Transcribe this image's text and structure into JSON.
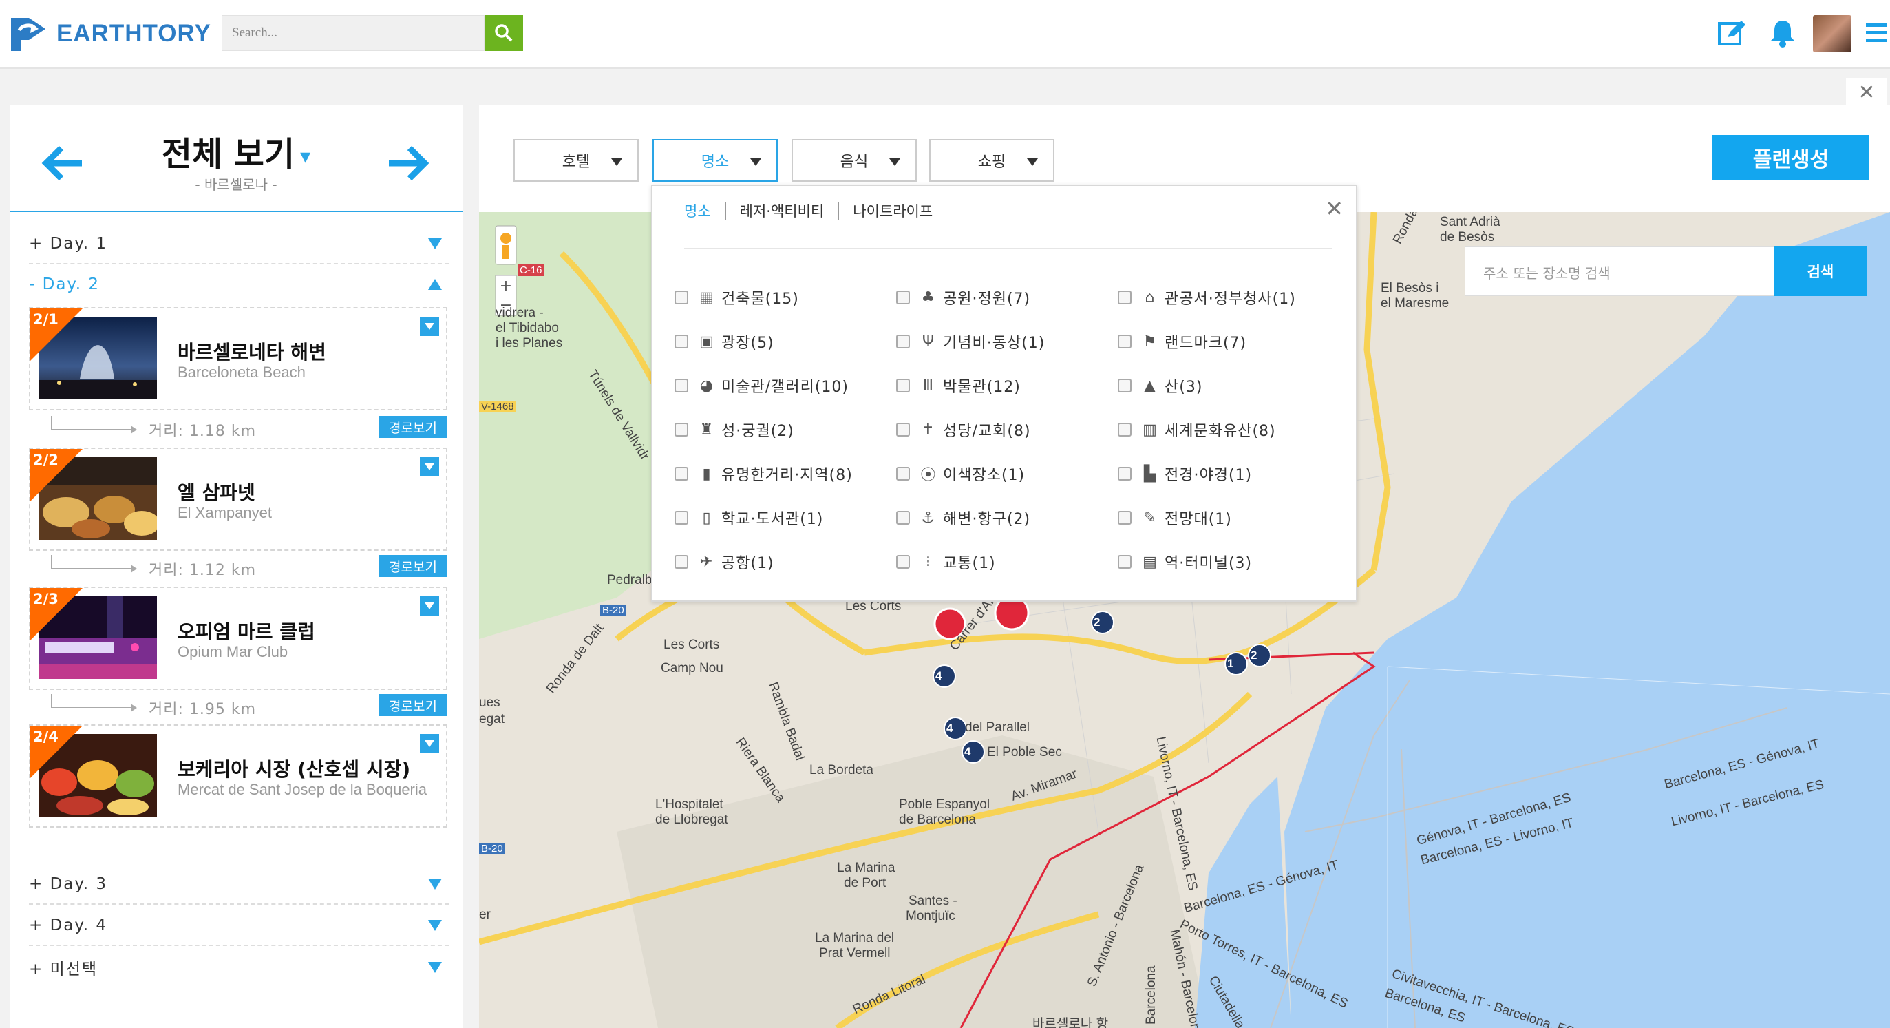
{
  "header": {
    "brand": "EARTHTORY",
    "search_placeholder": "Search...",
    "icons": [
      "edit-icon",
      "bell-icon",
      "avatar",
      "menu-icon"
    ]
  },
  "left_panel": {
    "title": "전체 보기",
    "subtitle": "- 바르셀로나 -",
    "days": {
      "day1": "+ Day. 1",
      "day2": "- Day. 2",
      "day3": "+ Day. 3",
      "day4": "+ Day. 4",
      "unselected": "+ 미선택"
    },
    "places": [
      {
        "badge": "2/1",
        "name": "바르셀로네타 해변",
        "en": "Barceloneta Beach",
        "distance": "거리: 1.18 km",
        "route": "경로보기"
      },
      {
        "badge": "2/2",
        "name": "엘 삼파넷",
        "en": "El Xampanyet",
        "distance": "거리: 1.12 km",
        "route": "경로보기"
      },
      {
        "badge": "2/3",
        "name": "오피엄 마르 클럽",
        "en": "Opium Mar Club",
        "distance": "거리: 1.95 km",
        "route": "경로보기"
      },
      {
        "badge": "2/4",
        "name": "보케리아 시장 (산호셉 시장)",
        "en": "Mercat de Sant Josep de la Boqueria"
      }
    ]
  },
  "filters": {
    "hotel": "호텔",
    "sights": "명소",
    "food": "음식",
    "shopping": "쇼핑",
    "plan_button": "플랜생성"
  },
  "dropdown": {
    "tabs": [
      "명소",
      "레저·액티비티",
      "나이트라이프"
    ],
    "categories": [
      [
        "건축물(15)",
        "공원·정원(7)",
        "관공서·정부청사(1)"
      ],
      [
        "광장(5)",
        "기념비·동상(1)",
        "랜드마크(7)"
      ],
      [
        "미술관/갤러리(10)",
        "박물관(12)",
        "산(3)"
      ],
      [
        "성·궁궐(2)",
        "성당/교회(8)",
        "세계문화유산(8)"
      ],
      [
        "유명한거리·지역(8)",
        "이색장소(1)",
        "전경·야경(1)"
      ],
      [
        "학교·도서관(1)",
        "해변·항구(2)",
        "전망대(1)"
      ],
      [
        "공항(1)",
        "교통(1)",
        "역·터미널(3)"
      ]
    ]
  },
  "map": {
    "search_placeholder": "주소 또는 장소명 검색",
    "search_button": "검색",
    "labels": {
      "sant_adria": "Sant Adrià",
      "de_besos": "de Besòs",
      "el_besos": "El Besòs i",
      "el_maresme": "el Maresme",
      "vidrera": "vidrera -",
      "tibidabo": "el Tibidabo",
      "planes": "i les Planes",
      "c16": "C-16",
      "b20": "B-20",
      "b20b": "B-20",
      "v1468": "V-1468",
      "pedralbes": "Pedralb",
      "les_corts": "Les Corts",
      "les_corts2": "Les Corts",
      "camp_nou": "Camp Nou",
      "ues": "ues",
      "egat": "egat",
      "ronda_dalt": "Ronda de Dalt",
      "rambla_badal": "Rambla Badal",
      "riera_blanca": "Riera Blanca",
      "la_bordeta": "La Bordeta",
      "hospitalet1": "L'Hospitalet",
      "hospitalet2": "de Llobregat",
      "poble_esp1": "Poble Espanyol",
      "poble_esp2": "de Barcelona",
      "el_parallel": "del Parallel",
      "poble_sec": "El Poble Sec",
      "miramar": "Av. Miramar",
      "la_marina1": "La Marina",
      "la_marina2": "de Port",
      "santes1": "Santes -",
      "santes2": "Montjuïc",
      "marina_prat1": "La Marina del",
      "marina_prat2": "Prat Vermell",
      "ronda_litoral": "Ronda Litoral",
      "ronda_litoral2": "Ronda Litoral",
      "carrer": "Carrer d'Arag",
      "tunels": "Túnels de Vallvidr",
      "livorno_bcn": "Livorno, IT - Barcelona, ES",
      "genova_bcn": "Génova, IT - Barcelona, ES",
      "bcn_genova": "Barcelona, ES - Génova, IT",
      "bcn_livorno": "Barcelona, ES - Livorno, IT",
      "bcn_genova2": "Barcelona, ES - Génova, IT",
      "porto_torres": "Porto Torres, IT - Barcelona, ES",
      "civitavecchia": "Civitavecchia, IT - Barcelona, ES",
      "bcn_es": "Barcelona, ES",
      "bcn_port": "바르셀로나 항",
      "livorno_vert": "Livorno, IT - Barcelona, ES",
      "mahon": "Mahón - Barcelona",
      "ciutadella": "Ciutadella",
      "s_antonio": "S. Antonio - Barcelona",
      "barcelona_v": "Barcelona",
      "er": "er"
    },
    "markers": [
      "4",
      "4",
      "4",
      "2",
      "1",
      "2"
    ],
    "colors": {
      "water": "#a9d0f5",
      "land": "#e9e4da",
      "road": "#f7d254",
      "marker": "#e0263a"
    }
  }
}
